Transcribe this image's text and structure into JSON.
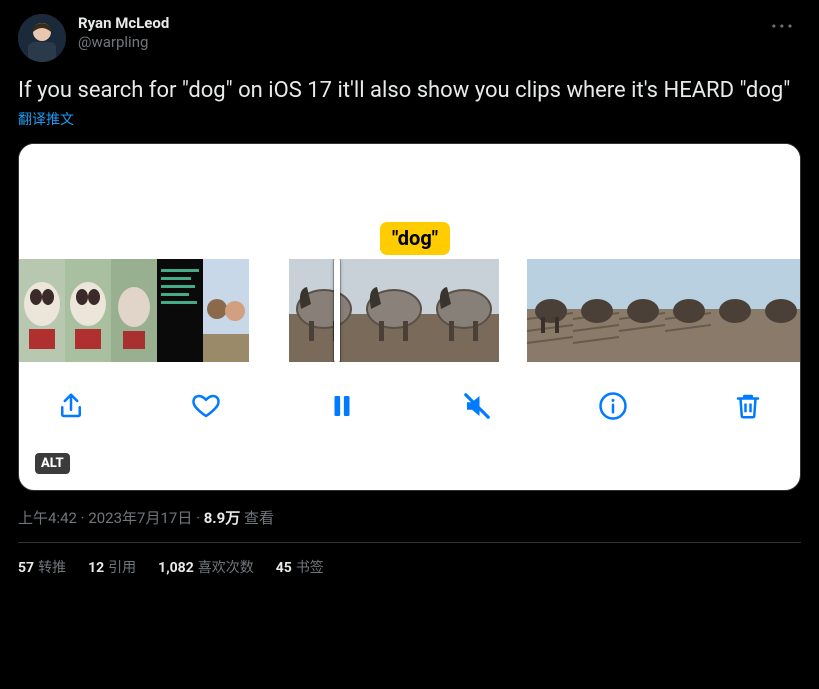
{
  "author": {
    "display_name": "Ryan McLeod",
    "handle": "@warpling"
  },
  "tweet_text": "If you search for \"dog\" on iOS 17 it'll also show you clips where it's HEARD \"dog\"",
  "translate_label": "翻译推文",
  "media": {
    "tag_text": "\"dog\"",
    "alt_label": "ALT"
  },
  "meta": {
    "time": "上午4:42",
    "date": "2023年7月17日",
    "views_number": "8.9万",
    "views_label": "查看"
  },
  "stats": {
    "retweets_num": "57",
    "retweets_label": "转推",
    "quotes_num": "12",
    "quotes_label": "引用",
    "likes_num": "1,082",
    "likes_label": "喜欢次数",
    "bookmarks_num": "45",
    "bookmarks_label": "书签"
  }
}
